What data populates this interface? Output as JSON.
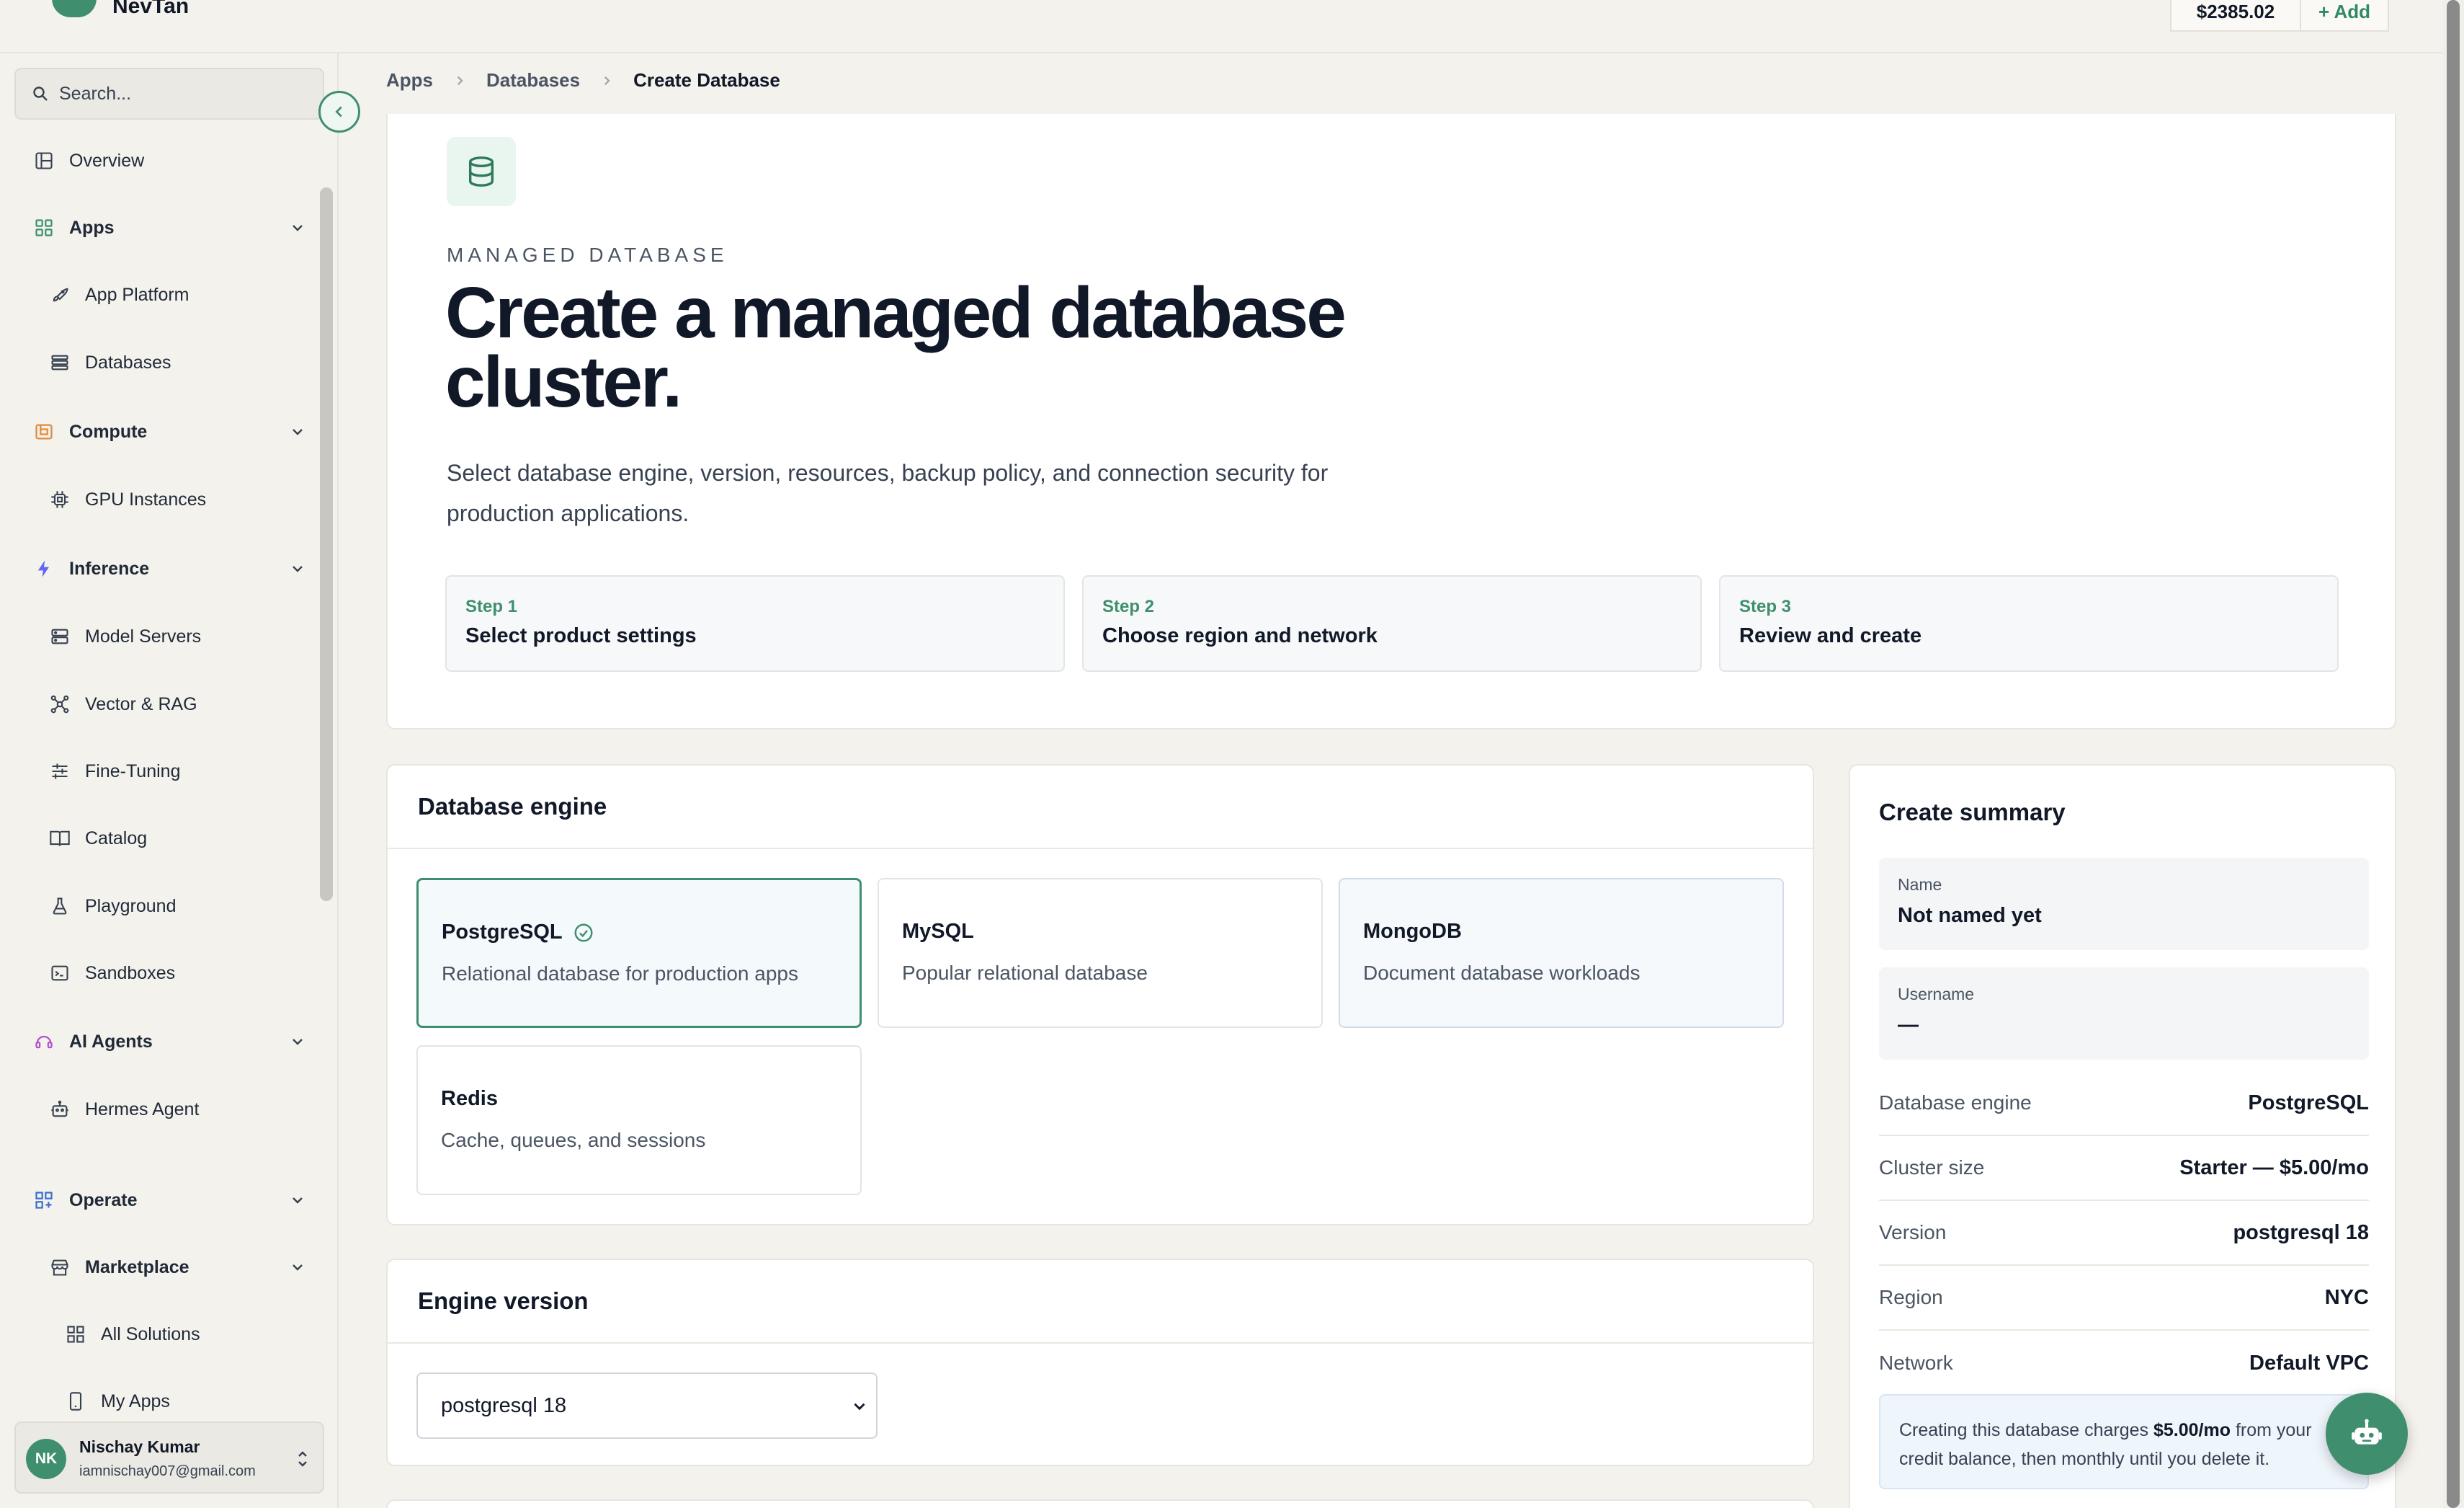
{
  "brand": {
    "name": "NevTan"
  },
  "account": {
    "balance": "$2385.02",
    "add_label": "+ Add"
  },
  "search": {
    "placeholder": "Search..."
  },
  "sidebar": {
    "items": [
      {
        "label": "Overview"
      },
      {
        "label": "Apps"
      },
      {
        "label": "App Platform"
      },
      {
        "label": "Databases"
      },
      {
        "label": "Compute"
      },
      {
        "label": "GPU Instances"
      },
      {
        "label": "Inference"
      },
      {
        "label": "Model Servers"
      },
      {
        "label": "Vector & RAG"
      },
      {
        "label": "Fine-Tuning"
      },
      {
        "label": "Catalog"
      },
      {
        "label": "Playground"
      },
      {
        "label": "Sandboxes"
      },
      {
        "label": "AI Agents"
      },
      {
        "label": "Hermes Agent"
      },
      {
        "label": "Operate"
      },
      {
        "label": "Marketplace"
      },
      {
        "label": "All Solutions"
      },
      {
        "label": "My Apps"
      }
    ]
  },
  "user": {
    "initials": "NK",
    "name": "Nischay Kumar",
    "email": "iamnischay007@gmail.com"
  },
  "breadcrumb": {
    "items": [
      "Apps",
      "Databases",
      "Create Database"
    ]
  },
  "hero": {
    "eyebrow": "MANAGED DATABASE",
    "title": "Create a managed database cluster.",
    "description": "Select database engine, version, resources, backup policy, and connection security for production applications."
  },
  "steps": [
    {
      "label": "Step 1",
      "title": "Select product settings"
    },
    {
      "label": "Step 2",
      "title": "Choose region and network"
    },
    {
      "label": "Step 3",
      "title": "Review and create"
    }
  ],
  "engine": {
    "heading": "Database engine",
    "options": [
      {
        "name": "PostgreSQL",
        "desc": "Relational database for production apps"
      },
      {
        "name": "MySQL",
        "desc": "Popular relational database"
      },
      {
        "name": "MongoDB",
        "desc": "Document database workloads"
      },
      {
        "name": "Redis",
        "desc": "Cache, queues, and sessions"
      }
    ],
    "selected": "PostgreSQL"
  },
  "version": {
    "heading": "Engine version",
    "value": "postgresql 18"
  },
  "summary": {
    "title": "Create summary",
    "name_label": "Name",
    "name_value": "Not named yet",
    "username_label": "Username",
    "username_value": "—",
    "rows": [
      {
        "k": "Database engine",
        "v": "PostgreSQL"
      },
      {
        "k": "Cluster size",
        "v": "Starter — $5.00/mo"
      },
      {
        "k": "Version",
        "v": "postgresql 18"
      },
      {
        "k": "Region",
        "v": "NYC"
      },
      {
        "k": "Network",
        "v": "Default VPC"
      }
    ],
    "notice_pre": "Creating this database charges ",
    "notice_amount": "$5.00/mo",
    "notice_post": " from your credit balance, then monthly until you delete it."
  },
  "colors": {
    "accent": "#3f8f6f",
    "background": "#f4f2ec"
  },
  "icons": [
    "search-icon",
    "chevron-left-icon",
    "layout-icon",
    "apps-grid-icon",
    "rocket-icon",
    "database-list-icon",
    "cpu-icon",
    "bolt-icon",
    "server-icon",
    "network-icon",
    "sliders-icon",
    "book-icon",
    "flask-icon",
    "terminal-icon",
    "agent-icon",
    "robot-icon",
    "store-icon",
    "grid-icon",
    "phone-icon",
    "chevron-down-icon",
    "check-circle-icon",
    "database-icon",
    "chevrons-updown-icon",
    "chat-bot-icon"
  ]
}
